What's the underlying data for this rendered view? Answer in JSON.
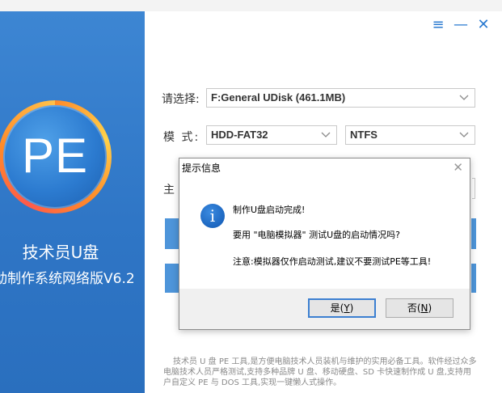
{
  "window": {
    "controls": [
      "≡",
      "—",
      "✕"
    ]
  },
  "sidebar": {
    "logo_text": "PE",
    "brand_name": "技术员U盘",
    "brand_subtitle": "动制作系统网络版V6.2"
  },
  "form": {
    "select_label": "请选择:",
    "drive_value": "F:General UDisk (461.1MB)",
    "mode_label": "模  式:",
    "mode_value": "HDD-FAT32",
    "fs_value": "NTFS",
    "main_label": "主"
  },
  "dialog": {
    "title": "提示信息",
    "close": "✕",
    "icon_glyph": "i",
    "line1": "制作U盘启动完成!",
    "line2": "要用 \"电脑模拟器\" 测试U盘的启动情况吗?",
    "line3": "注意:模拟器仅作启动测试,建议不要测试PE等工具!",
    "yes_label": "是",
    "yes_key": "Y",
    "no_label": "否",
    "no_key": "N"
  },
  "footer_text": "技术员 U 盘 PE 工具,是方便电脑技术人员装机与维护的实用必备工具。软件经过众多电脑技术人员严格测试,支持多种品牌 U 盘、移动硬盘、SD 卡快速制作成 U 盘,支持用户自定义 PE 与 DOS 工具,实现一键懒人式操作。",
  "colors": {
    "sidebar_blue": "#3d86d3",
    "accent_blue": "#2a7ad0",
    "logo_orange": "#ff8a2a"
  }
}
